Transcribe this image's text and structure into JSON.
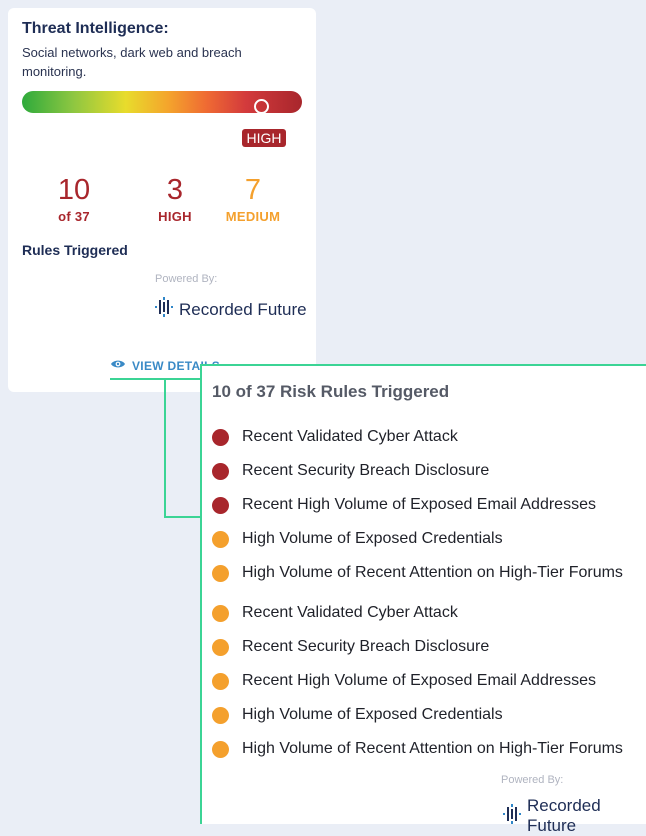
{
  "card": {
    "title": "Threat Intelligence:",
    "description": "Social networks, dark web and breach monitoring.",
    "risk_level": "HIGH",
    "gauge_value": 0.84,
    "stats": {
      "total_num": "10",
      "total_label": "of 37",
      "high_num": "3",
      "high_label": "HIGH",
      "medium_num": "7",
      "medium_label": "MEDIUM"
    },
    "rules_triggered": "Rules Triggered",
    "powered_by": "Powered By:",
    "logo_text": "Recorded Future",
    "view_details": "VIEW DETAILS"
  },
  "popup": {
    "title": "10 of 37 Risk Rules Triggered",
    "rules": [
      {
        "label": "Recent Validated Cyber Attack",
        "severity": "high"
      },
      {
        "label": "Recent Security Breach Disclosure",
        "severity": "high"
      },
      {
        "label": "Recent High Volume of Exposed Email Addresses",
        "severity": "high"
      },
      {
        "label": "High Volume of Exposed Credentials",
        "severity": "medium"
      },
      {
        "label": "High Volume of Recent Attention on High-Tier Forums",
        "severity": "medium"
      },
      {
        "label": "Recent Validated Cyber Attack",
        "severity": "medium"
      },
      {
        "label": "Recent Security Breach Disclosure",
        "severity": "medium"
      },
      {
        "label": "Recent High Volume of Exposed Email Addresses",
        "severity": "medium"
      },
      {
        "label": "High Volume of Exposed Credentials",
        "severity": "medium"
      },
      {
        "label": "High Volume of Recent Attention on High-Tier Forums",
        "severity": "medium"
      }
    ],
    "powered_by": "Powered By:",
    "logo_text": "Recorded Future"
  },
  "colors": {
    "high": "#a8262c",
    "medium": "#f4a02d",
    "accent": "#3bd495",
    "link": "#3a8ac6",
    "navy": "#1e2d55"
  },
  "icons": {
    "view_details": "eye-icon",
    "logo": "recorded-future-logo-icon"
  }
}
